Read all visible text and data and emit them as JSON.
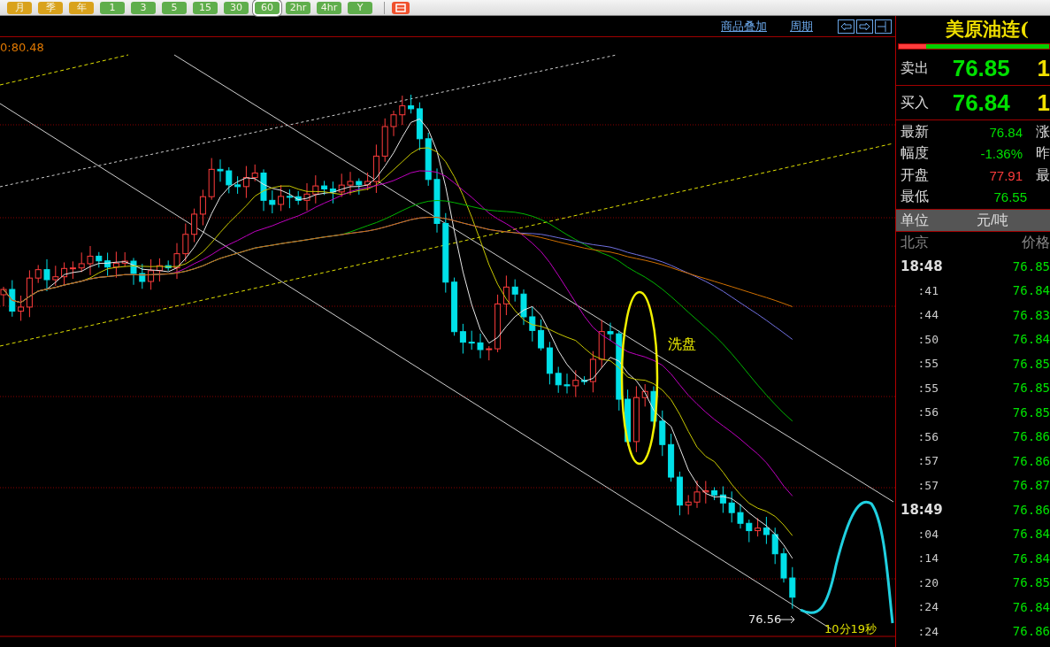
{
  "toolbar": {
    "buttons": [
      {
        "label": "月",
        "color": "#d9a21c",
        "selected": false
      },
      {
        "label": "季",
        "color": "#d9a21c",
        "selected": false
      },
      {
        "label": "年",
        "color": "#d9a21c",
        "selected": false
      },
      {
        "label": "1",
        "color": "#5fae4c",
        "selected": false
      },
      {
        "label": "3",
        "color": "#5fae4c",
        "selected": false
      },
      {
        "label": "5",
        "color": "#5fae4c",
        "selected": false
      },
      {
        "label": "15",
        "color": "#5fae4c",
        "selected": false
      },
      {
        "label": "30",
        "color": "#5fae4c",
        "selected": false
      },
      {
        "label": "60",
        "color": "#5fae4c",
        "selected": true
      },
      {
        "label": "2hr",
        "color": "#5fae4c",
        "selected": false
      },
      {
        "label": "4hr",
        "color": "#5fae4c",
        "selected": false
      },
      {
        "label": "Y",
        "color": "#5fae4c",
        "selected": false
      }
    ]
  },
  "chart": {
    "links": [
      "商品叠加",
      "周期"
    ],
    "price_label": "0:80.48",
    "annotation": "洗盘",
    "last_price_label": "76.56",
    "countdown": "10分19秒"
  },
  "quote": {
    "title": "美原油连(",
    "ratio_bar": {
      "level": 0.18
    },
    "bid_ask": [
      {
        "label": "卖出",
        "price": "76.85",
        "volume": "1"
      },
      {
        "label": "买入",
        "price": "76.84",
        "volume": "1"
      }
    ],
    "stats": [
      {
        "label": "最新",
        "value": "76.84",
        "color": "#00e000",
        "side_label": "涨"
      },
      {
        "label": "幅度",
        "value": "-1.36%",
        "color": "#00e000",
        "side_label": "昨"
      },
      {
        "label": "开盘",
        "value": "77.91",
        "color": "#ff3c3c",
        "side_label": "最"
      },
      {
        "label": "最低",
        "value": "76.55",
        "color": "#00e000"
      }
    ],
    "unit": {
      "label": "单位",
      "value": "元/吨"
    },
    "ticks_header": {
      "time": "北京",
      "price": "价格"
    },
    "ticks": [
      {
        "time": "18:48",
        "price": "76.85",
        "kind": "minute"
      },
      {
        "time": ":41",
        "price": "76.84",
        "kind": "second"
      },
      {
        "time": ":44",
        "price": "76.83",
        "kind": "second"
      },
      {
        "time": ":50",
        "price": "76.84",
        "kind": "second"
      },
      {
        "time": ":55",
        "price": "76.85",
        "kind": "second"
      },
      {
        "time": ":55",
        "price": "76.85",
        "kind": "second"
      },
      {
        "time": ":56",
        "price": "76.85",
        "kind": "second"
      },
      {
        "time": ":56",
        "price": "76.86",
        "kind": "second"
      },
      {
        "time": ":57",
        "price": "76.86",
        "kind": "second"
      },
      {
        "time": ":57",
        "price": "76.87",
        "kind": "second"
      },
      {
        "time": "18:49",
        "price": "76.86",
        "kind": "minute"
      },
      {
        "time": ":04",
        "price": "76.84",
        "kind": "second"
      },
      {
        "time": ":14",
        "price": "76.84",
        "kind": "second"
      },
      {
        "time": ":20",
        "price": "76.85",
        "kind": "second"
      },
      {
        "time": ":24",
        "price": "76.84",
        "kind": "second"
      },
      {
        "time": ":24",
        "price": "76.86",
        "kind": "second"
      }
    ]
  }
}
